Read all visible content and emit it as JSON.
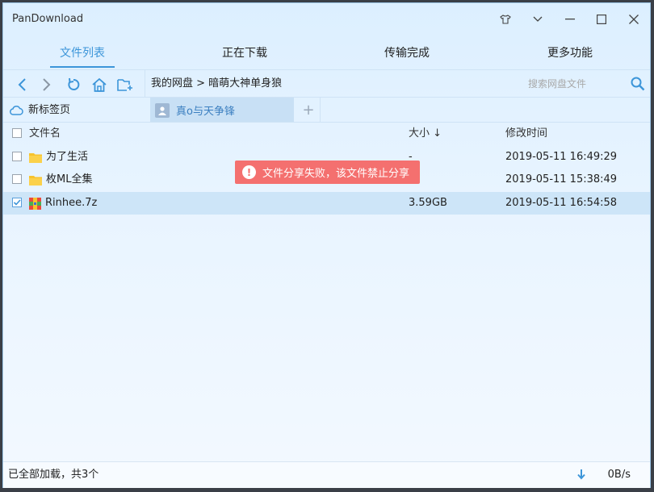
{
  "app": {
    "title": "PanDownload"
  },
  "tabs": [
    {
      "label": "文件列表",
      "active": true
    },
    {
      "label": "正在下载",
      "active": false
    },
    {
      "label": "传输完成",
      "active": false
    },
    {
      "label": "更多功能",
      "active": false
    }
  ],
  "toolbar": {
    "path": "我的网盘 > 暗萌大神单身狼",
    "search_placeholder": "搜索网盘文件"
  },
  "page_tabs": {
    "home_label": "新标签页",
    "user_label": "真o与天争锋",
    "add_label": "+"
  },
  "table": {
    "headers": {
      "name": "文件名",
      "size": "大小 ↓",
      "date": "修改时间"
    },
    "rows": [
      {
        "name": "为了生活",
        "size": "-",
        "date": "2019-05-11 16:49:29",
        "type": "folder",
        "checked": false
      },
      {
        "name": "枚ML全集",
        "size": "",
        "date": "2019-05-11 15:38:49",
        "type": "folder",
        "checked": false
      },
      {
        "name": "Rinhee.7z",
        "size": "3.59GB",
        "date": "2019-05-11 16:54:58",
        "type": "archive",
        "checked": true
      }
    ]
  },
  "toast": {
    "message": "文件分享失败，该文件禁止分享",
    "icon": "!"
  },
  "status": {
    "text": "已全部加载，共3个",
    "speed": "0B/s"
  },
  "colors": {
    "accent": "#3c95d9",
    "toast": "#f4706f",
    "folder": "#f7c32e"
  }
}
